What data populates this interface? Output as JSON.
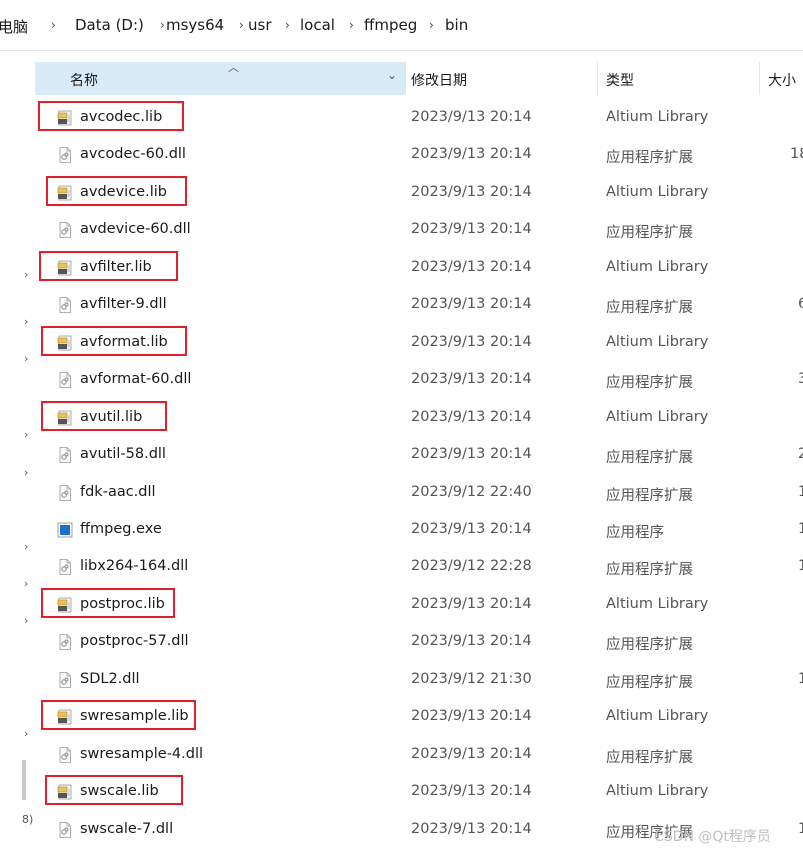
{
  "breadcrumb": [
    "电脑",
    "Data (D:)",
    "msys64",
    "usr",
    "local",
    "ffmpeg",
    "bin"
  ],
  "columns": {
    "name": "名称",
    "date": "修改日期",
    "type": "类型",
    "size": "大小"
  },
  "files": [
    {
      "name": "avcodec.lib",
      "date": "2023/9/13 20:14",
      "type": "Altium Library",
      "size": "",
      "icon": "lib-file-icon",
      "highlighted": true
    },
    {
      "name": "avcodec-60.dll",
      "date": "2023/9/13 20:14",
      "type": "应用程序扩展",
      "size": "18",
      "icon": "dll-file-icon",
      "highlighted": false
    },
    {
      "name": "avdevice.lib",
      "date": "2023/9/13 20:14",
      "type": "Altium Library",
      "size": "",
      "icon": "lib-file-icon",
      "highlighted": true
    },
    {
      "name": "avdevice-60.dll",
      "date": "2023/9/13 20:14",
      "type": "应用程序扩展",
      "size": "",
      "icon": "dll-file-icon",
      "highlighted": false
    },
    {
      "name": "avfilter.lib",
      "date": "2023/9/13 20:14",
      "type": "Altium Library",
      "size": "",
      "icon": "lib-file-icon",
      "highlighted": true
    },
    {
      "name": "avfilter-9.dll",
      "date": "2023/9/13 20:14",
      "type": "应用程序扩展",
      "size": "6",
      "icon": "dll-file-icon",
      "highlighted": false
    },
    {
      "name": "avformat.lib",
      "date": "2023/9/13 20:14",
      "type": "Altium Library",
      "size": "",
      "icon": "lib-file-icon",
      "highlighted": true
    },
    {
      "name": "avformat-60.dll",
      "date": "2023/9/13 20:14",
      "type": "应用程序扩展",
      "size": "3",
      "icon": "dll-file-icon",
      "highlighted": false
    },
    {
      "name": "avutil.lib",
      "date": "2023/9/13 20:14",
      "type": "Altium Library",
      "size": "",
      "icon": "lib-file-icon",
      "highlighted": true
    },
    {
      "name": "avutil-58.dll",
      "date": "2023/9/13 20:14",
      "type": "应用程序扩展",
      "size": "2",
      "icon": "dll-file-icon",
      "highlighted": false
    },
    {
      "name": "fdk-aac.dll",
      "date": "2023/9/12 22:40",
      "type": "应用程序扩展",
      "size": "1",
      "icon": "dll-file-icon",
      "highlighted": false
    },
    {
      "name": "ffmpeg.exe",
      "date": "2023/9/13 20:14",
      "type": "应用程序",
      "size": "1",
      "icon": "exe-file-icon",
      "highlighted": false
    },
    {
      "name": "libx264-164.dll",
      "date": "2023/9/12 22:28",
      "type": "应用程序扩展",
      "size": "1",
      "icon": "dll-file-icon",
      "highlighted": false
    },
    {
      "name": "postproc.lib",
      "date": "2023/9/13 20:14",
      "type": "Altium Library",
      "size": "",
      "icon": "lib-file-icon",
      "highlighted": true
    },
    {
      "name": "postproc-57.dll",
      "date": "2023/9/13 20:14",
      "type": "应用程序扩展",
      "size": "",
      "icon": "dll-file-icon",
      "highlighted": false
    },
    {
      "name": "SDL2.dll",
      "date": "2023/9/12 21:30",
      "type": "应用程序扩展",
      "size": "1",
      "icon": "dll-file-icon",
      "highlighted": false
    },
    {
      "name": "swresample.lib",
      "date": "2023/9/13 20:14",
      "type": "Altium Library",
      "size": "",
      "icon": "lib-file-icon",
      "highlighted": true
    },
    {
      "name": "swresample-4.dll",
      "date": "2023/9/13 20:14",
      "type": "应用程序扩展",
      "size": "",
      "icon": "dll-file-icon",
      "highlighted": false
    },
    {
      "name": "swscale.lib",
      "date": "2023/9/13 20:14",
      "type": "Altium Library",
      "size": "",
      "icon": "lib-file-icon",
      "highlighted": true
    },
    {
      "name": "swscale-7.dll",
      "date": "2023/9/13 20:14",
      "type": "应用程序扩展",
      "size": "1",
      "icon": "dll-file-icon",
      "highlighted": false
    }
  ],
  "left_marks": [
    "›",
    "›",
    "›",
    "›",
    "›",
    "›",
    "›",
    "›",
    "›",
    "8)"
  ],
  "watermark": "CSDN @Qt程序员",
  "colors": {
    "highlight_box": "#e0212c",
    "header_bg": "#d9ebf7",
    "exe_icon": "#1e6fc8"
  }
}
